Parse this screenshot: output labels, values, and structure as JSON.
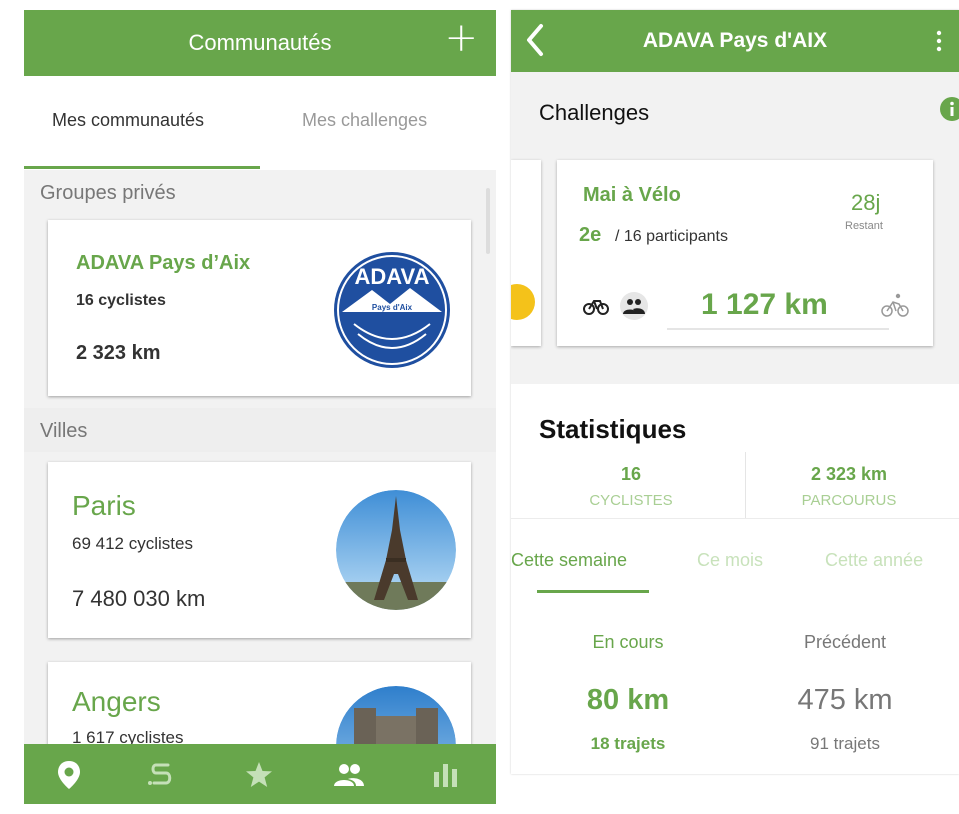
{
  "left": {
    "header": {
      "title": "Communautés",
      "add_icon": "plus-icon"
    },
    "tabs": [
      {
        "label": "Mes communautés",
        "active": true
      },
      {
        "label": "Mes challenges",
        "active": false
      }
    ],
    "private_section": {
      "title": "Groupes privés"
    },
    "private_group": {
      "name": "ADAVA Pays d’Aix",
      "cyclists": "16 cyclistes",
      "km": "2 323 km",
      "logo_text": "ADAVA",
      "logo_sub": "Pays d'Aix"
    },
    "cities_section": {
      "title": "Villes"
    },
    "cities": [
      {
        "name": "Paris",
        "cyclists": "69 412 cyclistes",
        "km": "7 480 030 km"
      },
      {
        "name": "Angers",
        "cyclists": "1 617 cyclistes"
      }
    ],
    "bottom_nav": [
      "map-pin-icon",
      "route-icon",
      "star-icon",
      "people-icon",
      "stats-icon"
    ]
  },
  "right": {
    "header": {
      "title": "ADAVA Pays d'AIX"
    },
    "challenges": {
      "title": "Challenges",
      "challenge": {
        "name": "Mai à Vélo",
        "rank": "2e",
        "participants": "/ 16 participants",
        "days": "28j",
        "days_label": "Restant",
        "distance": "1 127 km"
      }
    },
    "stats": {
      "title": "Statistiques",
      "cyclists_value": "16",
      "cyclists_label": "CYCLISTES",
      "km_value": "2 323 km",
      "km_label": "PARCOURUS",
      "tabs": [
        {
          "label": "Cette semaine",
          "active": true
        },
        {
          "label": "Ce mois",
          "active": false
        },
        {
          "label": "Cette année",
          "active": false
        }
      ],
      "current": {
        "label": "En cours",
        "km": "80 km",
        "trips": "18 trajets"
      },
      "previous": {
        "label": "Précédent",
        "km": "475 km",
        "trips": "91 trajets"
      }
    }
  },
  "colors": {
    "brand_green": "#68a64b",
    "light_green": "#a9cf94",
    "adava_blue": "#1f4fa0"
  }
}
